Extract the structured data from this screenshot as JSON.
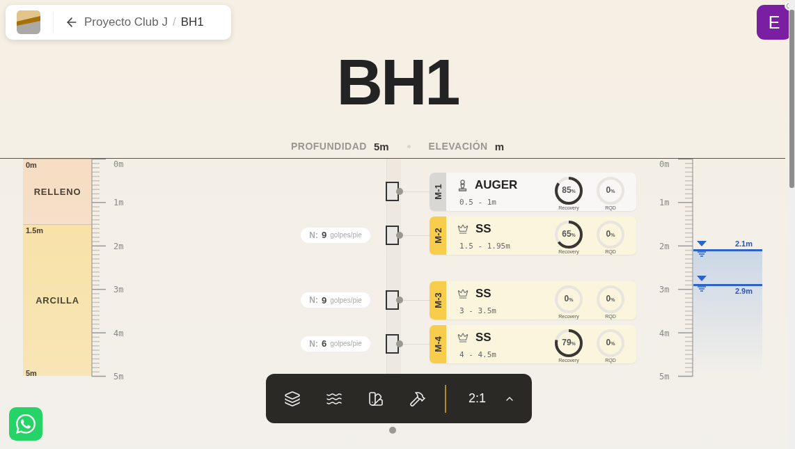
{
  "breadcrumb": {
    "project": "Proyecto Club J",
    "separator": "/",
    "current": "BH1"
  },
  "avatar": {
    "initial": "E"
  },
  "title": "BH1",
  "summary": [
    {
      "label": "PROFUNDIDAD",
      "value": "5m"
    },
    {
      "label": "ELEVACIÓN",
      "value": "m"
    }
  ],
  "left_scale": [
    "0m",
    "1m",
    "2m",
    "3m",
    "4m",
    "5m"
  ],
  "right_scale": [
    "0m",
    "1m",
    "2m",
    "3m",
    "4m",
    "5m"
  ],
  "layers": [
    {
      "name": "RELLENO",
      "top_label": "0m",
      "color": "#f6dcc2"
    },
    {
      "name": "ARCILLA",
      "top_label": "1.5m",
      "bottom_label": "5m",
      "color": "#f8e2a8"
    }
  ],
  "samples": [
    {
      "code": "M-1",
      "kind": "auger",
      "type": "AUGER",
      "range": "0.5 - 1m",
      "recovery": {
        "value": "85",
        "unit": "%",
        "label": "Recovery"
      },
      "rqd": {
        "value": "0",
        "unit": "%",
        "label": "RQD"
      }
    },
    {
      "code": "M-2",
      "kind": "ss",
      "type": "SS",
      "range": "1.5 - 1.95m",
      "blows": {
        "prefix": "N:",
        "count": "9",
        "unit": "golpes/pie"
      },
      "recovery": {
        "value": "65",
        "unit": "%",
        "label": "Recovery"
      },
      "rqd": {
        "value": "0",
        "unit": "%",
        "label": "RQD"
      }
    },
    {
      "code": "M-3",
      "kind": "ss",
      "type": "SS",
      "range": "3 - 3.5m",
      "blows": {
        "prefix": "N:",
        "count": "9",
        "unit": "golpes/pie"
      },
      "recovery": {
        "value": "0",
        "unit": "%",
        "label": "Recovery"
      },
      "rqd": {
        "value": "0",
        "unit": "%",
        "label": "RQD"
      }
    },
    {
      "code": "M-4",
      "kind": "ss",
      "type": "SS",
      "range": "4 - 4.5m",
      "blows": {
        "prefix": "N:",
        "count": "6",
        "unit": "golpes/pie"
      },
      "recovery": {
        "value": "79",
        "unit": "%",
        "label": "Recovery"
      },
      "rqd": {
        "value": "0",
        "unit": "%",
        "label": "RQD"
      }
    }
  ],
  "water_levels": [
    {
      "label": "2.1m"
    },
    {
      "label": "2.9m"
    }
  ],
  "toolbar": {
    "tools": [
      {
        "kind": "layers"
      },
      {
        "kind": "waves"
      },
      {
        "kind": "swatches"
      },
      {
        "kind": "hammer"
      }
    ],
    "scale": "2:1"
  }
}
